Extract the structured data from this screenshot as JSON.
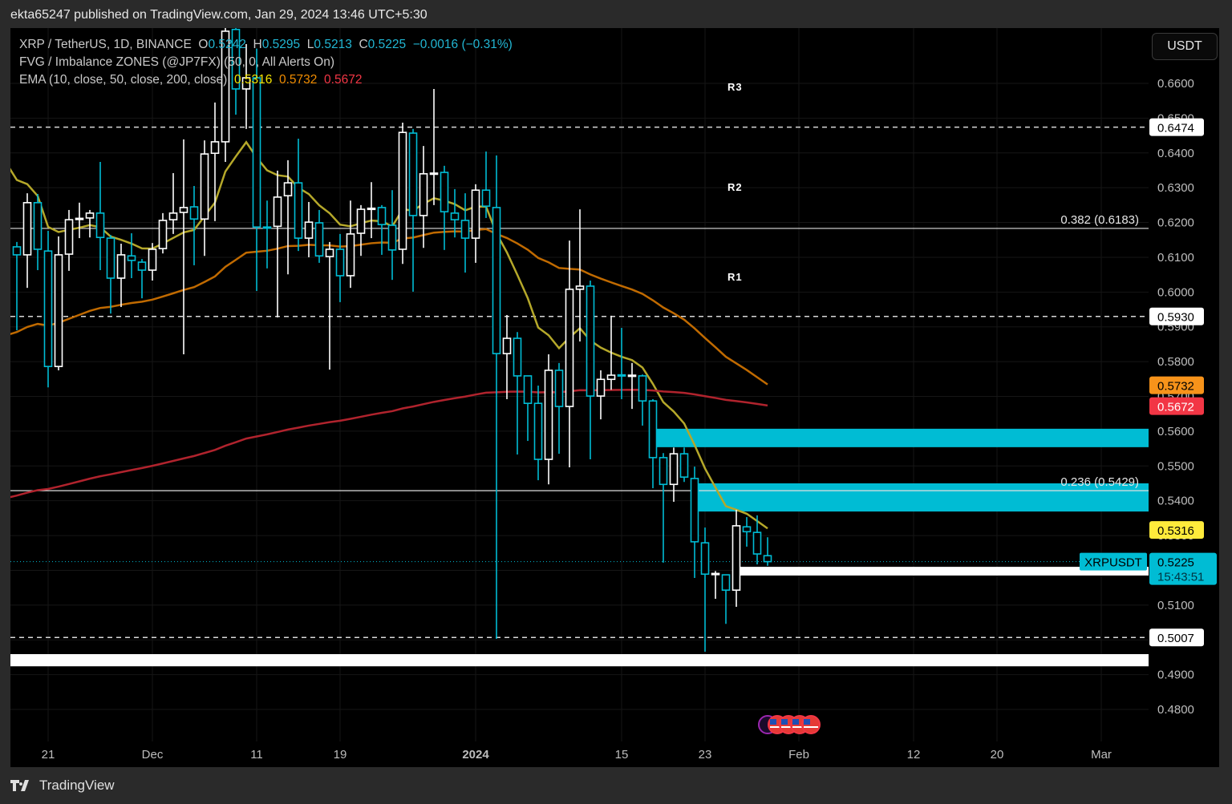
{
  "header": {
    "published": "ekta65247 published on TradingView.com, Jan 29, 2024 13:46 UTC+5:30"
  },
  "legend": {
    "symbol": "XRP / TetherUS, 1D, BINANCE",
    "o_label": "O",
    "o": "0.5242",
    "h_label": "H",
    "h": "0.5295",
    "l_label": "L",
    "l": "0.5213",
    "c_label": "C",
    "c": "0.5225",
    "change": "−0.0016 (−0.31%)",
    "fvg": "FVG / Imbalance ZONES (@JP7FX) (50, 0, All Alerts On)",
    "ema": "EMA (10, close, 50, close, 200, close)",
    "ema10": "0.5316",
    "ema50": "0.5732",
    "ema200": "0.5672"
  },
  "currency_button": "USDT",
  "footer": {
    "brand": "TradingView"
  },
  "pivot_labels": [
    "R3",
    "R2",
    "R1"
  ],
  "colors": {
    "up": "#ffffff",
    "down": "#00bcd4",
    "ema10": "#b5a82a",
    "ema50": "#c06a00",
    "ema200": "#b0232d",
    "fvg": "#00bcd4",
    "bg": "#000000"
  },
  "chart_data": {
    "type": "candlestick",
    "symbol": "XRPUSDT",
    "interval": "1D",
    "start_date": "2023-11-18",
    "ylim": [
      0.475,
      0.68
    ],
    "y_ticks": [
      0.48,
      0.49,
      0.5,
      0.51,
      0.52,
      0.53,
      0.54,
      0.55,
      0.56,
      0.57,
      0.58,
      0.59,
      0.6,
      0.61,
      0.62,
      0.63,
      0.64,
      0.65,
      0.66
    ],
    "x_ticks": [
      {
        "label": "21",
        "date": "2023-11-21"
      },
      {
        "label": "Dec",
        "date": "2023-12-01"
      },
      {
        "label": "11",
        "date": "2023-12-11"
      },
      {
        "label": "19",
        "date": "2023-12-19"
      },
      {
        "label": "2024",
        "date": "2024-01-01",
        "bold": true
      },
      {
        "label": "15",
        "date": "2024-01-15"
      },
      {
        "label": "23",
        "date": "2024-01-23"
      },
      {
        "label": "Feb",
        "date": "2024-02-01"
      },
      {
        "label": "12",
        "date": "2024-02-12"
      },
      {
        "label": "20",
        "date": "2024-02-20"
      },
      {
        "label": "Mar",
        "date": "2024-03-01"
      }
    ],
    "x_end_date": "2024-03-09",
    "ohlc": [
      [
        0.613,
        0.6144,
        0.589,
        0.6107
      ],
      [
        0.6107,
        0.6284,
        0.6012,
        0.6257
      ],
      [
        0.6257,
        0.6282,
        0.6063,
        0.6123
      ],
      [
        0.6118,
        0.6176,
        0.5726,
        0.5786
      ],
      [
        0.5786,
        0.616,
        0.5775,
        0.6107
      ],
      [
        0.6109,
        0.6236,
        0.6061,
        0.6208
      ],
      [
        0.621,
        0.6257,
        0.6155,
        0.6212
      ],
      [
        0.6213,
        0.6236,
        0.6157,
        0.6227
      ],
      [
        0.6227,
        0.6374,
        0.6063,
        0.6157
      ],
      [
        0.6155,
        0.6164,
        0.5938,
        0.604
      ],
      [
        0.604,
        0.6139,
        0.5957,
        0.6107
      ],
      [
        0.6104,
        0.6169,
        0.604,
        0.6091
      ],
      [
        0.6086,
        0.6095,
        0.5982,
        0.6063
      ],
      [
        0.6063,
        0.6141,
        0.6033,
        0.6123
      ],
      [
        0.6125,
        0.6227,
        0.6111,
        0.6206
      ],
      [
        0.6208,
        0.6342,
        0.6167,
        0.6227
      ],
      [
        0.6229,
        0.6439,
        0.5821,
        0.6243
      ],
      [
        0.6245,
        0.6305,
        0.6077,
        0.621
      ],
      [
        0.621,
        0.6436,
        0.6104,
        0.6397
      ],
      [
        0.6399,
        0.6545,
        0.6204,
        0.6432
      ],
      [
        0.6432,
        0.68,
        0.6374,
        0.675
      ],
      [
        0.6755,
        0.676,
        0.651,
        0.6584
      ],
      [
        0.6584,
        0.6713,
        0.6469,
        0.6616
      ],
      [
        0.6616,
        0.67,
        0.6003,
        0.6187
      ],
      [
        0.6187,
        0.6263,
        0.6068,
        0.6185
      ],
      [
        0.6189,
        0.6349,
        0.5927,
        0.6273
      ],
      [
        0.6277,
        0.6379,
        0.6051,
        0.6314
      ],
      [
        0.6314,
        0.6441,
        0.6118,
        0.6155
      ],
      [
        0.6155,
        0.6259,
        0.61,
        0.6201
      ],
      [
        0.6199,
        0.6236,
        0.6084,
        0.6104
      ],
      [
        0.6102,
        0.6144,
        0.5777,
        0.6123
      ],
      [
        0.6123,
        0.6167,
        0.5971,
        0.6047
      ],
      [
        0.6047,
        0.6263,
        0.6012,
        0.6167
      ],
      [
        0.6169,
        0.625,
        0.6104,
        0.6238
      ],
      [
        0.624,
        0.6316,
        0.6155,
        0.6241
      ],
      [
        0.6243,
        0.625,
        0.6107,
        0.6194
      ],
      [
        0.6192,
        0.6293,
        0.6035,
        0.6121
      ],
      [
        0.6123,
        0.6487,
        0.6081,
        0.6459
      ],
      [
        0.6457,
        0.6469,
        0.6001,
        0.622
      ],
      [
        0.622,
        0.642,
        0.6127,
        0.634
      ],
      [
        0.634,
        0.6584,
        0.625,
        0.6342
      ],
      [
        0.6344,
        0.6363,
        0.6121,
        0.6231
      ],
      [
        0.6227,
        0.6296,
        0.6157,
        0.6208
      ],
      [
        0.6206,
        0.6284,
        0.6056,
        0.6155
      ],
      [
        0.6155,
        0.631,
        0.6084,
        0.6293
      ],
      [
        0.6293,
        0.6404,
        0.6213,
        0.6247
      ],
      [
        0.6243,
        0.6393,
        0.5003,
        0.5823
      ],
      [
        0.5823,
        0.5934,
        0.5692,
        0.5867
      ],
      [
        0.5867,
        0.5885,
        0.5533,
        0.5759
      ],
      [
        0.5759,
        0.5759,
        0.5572,
        0.568
      ],
      [
        0.568,
        0.5731,
        0.5459,
        0.5519
      ],
      [
        0.5519,
        0.5821,
        0.5447,
        0.5775
      ],
      [
        0.5775,
        0.5796,
        0.5535,
        0.5671
      ],
      [
        0.5671,
        0.6148,
        0.5496,
        0.6008
      ],
      [
        0.6008,
        0.6238,
        0.5858,
        0.6017
      ],
      [
        0.6017,
        0.6033,
        0.5519,
        0.5701
      ],
      [
        0.5701,
        0.5775,
        0.5634,
        0.5749
      ],
      [
        0.5749,
        0.5932,
        0.5719,
        0.5761
      ],
      [
        0.5762,
        0.5897,
        0.5692,
        0.576
      ],
      [
        0.5759,
        0.5796,
        0.5664,
        0.5761
      ],
      [
        0.5759,
        0.5763,
        0.5616,
        0.5687
      ],
      [
        0.5687,
        0.5692,
        0.5436,
        0.5524
      ],
      [
        0.5524,
        0.5537,
        0.5222,
        0.5447
      ],
      [
        0.5447,
        0.5553,
        0.5397,
        0.5535
      ],
      [
        0.5535,
        0.5553,
        0.5454,
        0.5468
      ],
      [
        0.5464,
        0.5498,
        0.5178,
        0.5282
      ],
      [
        0.5279,
        0.5323,
        0.4966,
        0.5189
      ],
      [
        0.519,
        0.5198,
        0.5118,
        0.5191
      ],
      [
        0.5187,
        0.5187,
        0.5046,
        0.5143
      ],
      [
        0.5143,
        0.5374,
        0.5095,
        0.5328
      ],
      [
        0.5325,
        0.5353,
        0.5268,
        0.5311
      ],
      [
        0.5309,
        0.5358,
        0.5217,
        0.5247
      ],
      [
        0.5242,
        0.5295,
        0.5213,
        0.5225
      ]
    ],
    "ema_seed": {
      "ema10": 0.637,
      "ema50": 0.5876,
      "ema200": 0.5408
    },
    "dashed_levels": [
      {
        "value": 0.6474,
        "label": "0.6474"
      },
      {
        "value": 0.593,
        "label": "0.5930"
      },
      {
        "value": 0.5007,
        "label": "0.5007"
      }
    ],
    "fib_levels": [
      {
        "value": 0.6183,
        "label": "0.382 (0.6183)",
        "from": "2023-11-18"
      },
      {
        "value": 0.5429,
        "label": "0.236 (0.5429)",
        "from": "2023-11-18"
      }
    ],
    "fvg_zones": [
      {
        "top": 0.5607,
        "bottom": 0.5554,
        "from": "2024-01-18",
        "color": "#00bcd4"
      },
      {
        "top": 0.545,
        "bottom": 0.5369,
        "from": "2024-01-22",
        "color": "#00bcd4"
      },
      {
        "top": 0.521,
        "bottom": 0.5185,
        "from": "2024-01-26",
        "color": "#ffffff"
      },
      {
        "top": 0.4959,
        "bottom": 0.4924,
        "from": "2023-11-01",
        "color": "#ffffff"
      }
    ],
    "pivots": [
      {
        "label": "R3",
        "value": 0.6585
      },
      {
        "label": "R2",
        "value": 0.6296
      },
      {
        "label": "R1",
        "value": 0.604
      }
    ],
    "price_tags": [
      {
        "label": "0.5732",
        "value": 0.5732,
        "bg": "#f7931a",
        "fg": "#000"
      },
      {
        "label": "0.5672",
        "value": 0.5672,
        "bg": "#f23645",
        "fg": "#fff"
      },
      {
        "label": "0.5316",
        "value": 0.5316,
        "bg": "#ffeb3b",
        "fg": "#000"
      }
    ],
    "last_price": {
      "symbol": "XRPUSDT",
      "label": "0.5225",
      "value": 0.5225,
      "countdown": "15:43:51"
    },
    "events_date": "2024-01-29"
  }
}
